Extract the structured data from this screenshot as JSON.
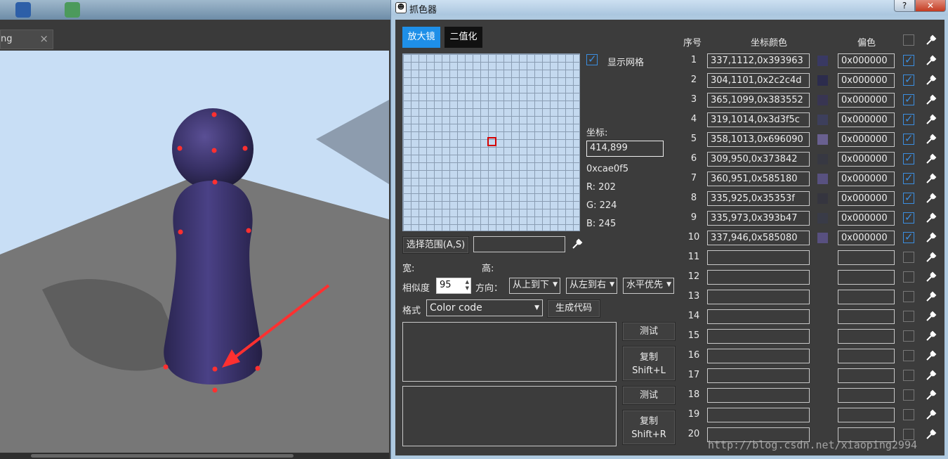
{
  "background_app": {
    "tab_label": "ng",
    "tab_close": "×"
  },
  "picker": {
    "title": "抓色器",
    "window_buttons": {
      "help": "?",
      "close": "✕"
    },
    "tabs": {
      "magnifier": "放大镜",
      "binarize": "二值化"
    },
    "show_grid_label": "显示网格",
    "show_grid_checked": true,
    "coord_label": "坐标:",
    "coord_value": "414,899",
    "hex_value": "0xcae0f5",
    "r_text": "R:  202",
    "g_text": "G:  224",
    "b_text": "B:  245",
    "select_range_button": "选择范围(A,S)",
    "range_value": "",
    "width_label": "宽:",
    "height_label": "高:",
    "similarity_label": "相似度",
    "similarity_value": "95",
    "direction_label": "方向：",
    "direction_vertical": "从上到下",
    "direction_horizontal": "从左到右",
    "priority": "水平优先",
    "format_label": "格式",
    "format_value": "Color code",
    "generate_button": "生成代码",
    "test_button_1": "测试",
    "copy_button_1_line1": "复制",
    "copy_button_1_line2": "Shift+L",
    "test_button_2": "测试",
    "copy_button_2_line1": "复制",
    "copy_button_2_line2": "Shift+R",
    "table": {
      "headers": {
        "index": "序号",
        "coord_color": "坐标颜色",
        "offset": "偏色"
      },
      "rows": [
        {
          "n": "1",
          "value": "337,1112,0x393963",
          "color": "#393963",
          "offset": "0x000000",
          "checked": true
        },
        {
          "n": "2",
          "value": "304,1101,0x2c2c4d",
          "color": "#2c2c4d",
          "offset": "0x000000",
          "checked": true
        },
        {
          "n": "3",
          "value": "365,1099,0x383552",
          "color": "#383552",
          "offset": "0x000000",
          "checked": true
        },
        {
          "n": "4",
          "value": "319,1014,0x3d3f5c",
          "color": "#3d3f5c",
          "offset": "0x000000",
          "checked": true
        },
        {
          "n": "5",
          "value": "358,1013,0x696090",
          "color": "#696090",
          "offset": "0x000000",
          "checked": true
        },
        {
          "n": "6",
          "value": "309,950,0x373842",
          "color": "#373842",
          "offset": "0x000000",
          "checked": true
        },
        {
          "n": "7",
          "value": "360,951,0x585180",
          "color": "#585180",
          "offset": "0x000000",
          "checked": true
        },
        {
          "n": "8",
          "value": "335,925,0x35353f",
          "color": "#35353f",
          "offset": "0x000000",
          "checked": true
        },
        {
          "n": "9",
          "value": "335,973,0x393b47",
          "color": "#393b47",
          "offset": "0x000000",
          "checked": true
        },
        {
          "n": "10",
          "value": "337,946,0x585080",
          "color": "#585080",
          "offset": "0x000000",
          "checked": true
        },
        {
          "n": "11",
          "value": "",
          "color": "",
          "offset": "",
          "checked": false
        },
        {
          "n": "12",
          "value": "",
          "color": "",
          "offset": "",
          "checked": false
        },
        {
          "n": "13",
          "value": "",
          "color": "",
          "offset": "",
          "checked": false
        },
        {
          "n": "14",
          "value": "",
          "color": "",
          "offset": "",
          "checked": false
        },
        {
          "n": "15",
          "value": "",
          "color": "",
          "offset": "",
          "checked": false
        },
        {
          "n": "16",
          "value": "",
          "color": "",
          "offset": "",
          "checked": false
        },
        {
          "n": "17",
          "value": "",
          "color": "",
          "offset": "",
          "checked": false
        },
        {
          "n": "18",
          "value": "",
          "color": "",
          "offset": "",
          "checked": false
        },
        {
          "n": "19",
          "value": "",
          "color": "",
          "offset": "",
          "checked": false
        },
        {
          "n": "20",
          "value": "",
          "color": "",
          "offset": "",
          "checked": false
        }
      ]
    }
  },
  "watermark": "http://blog.csdn.net/xiaoping2994",
  "colors": {
    "accent": "#1e8fe8",
    "checkbox": "#3b8ee0",
    "panel": "#3c3c3c",
    "marker": "#ff3030"
  }
}
